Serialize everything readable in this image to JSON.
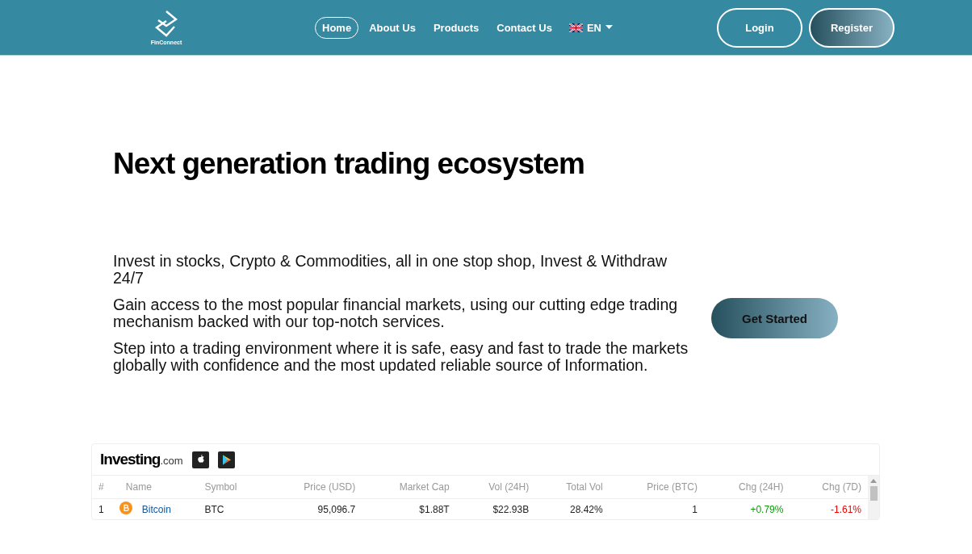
{
  "header": {
    "logo_text": "FinConnect",
    "nav": [
      {
        "label": "Home",
        "selected": true
      },
      {
        "label": "About Us",
        "selected": false
      },
      {
        "label": "Products",
        "selected": false
      },
      {
        "label": "Contact Us",
        "selected": false
      }
    ],
    "language": "EN",
    "buttons": [
      {
        "label": "Login",
        "kind": "outline"
      },
      {
        "label": "Register",
        "kind": "gradient"
      }
    ]
  },
  "hero": {
    "title": "Next generation trading ecosystem",
    "paragraphs": [
      "Invest in stocks, Crypto & Commodities, all in one stop shop, Invest & Withdraw 24/7",
      "Gain access to the most popular financial markets, using our cutting edge trading mechanism backed with our top-notch services.",
      "Step into a trading environment where it is safe, easy and fast to trade the markets globally with confidence and the most updated reliable source of Information."
    ],
    "cta": "Get Started"
  },
  "widget": {
    "brand": "Investing",
    "brand_suffix": ".com",
    "columns": [
      "#",
      "Name",
      "Symbol",
      "Price (USD)",
      "Market Cap",
      "Vol (24H)",
      "Total Vol",
      "Price (BTC)",
      "Chg (24H)",
      "Chg (7D)"
    ],
    "rows": [
      {
        "cells": [
          {
            "text": "1",
            "kind": "plain"
          },
          {
            "text": "Bitcoin",
            "kind": "link"
          },
          {
            "text": "BTC",
            "kind": "plain"
          },
          {
            "text": "95,096.7",
            "kind": "num"
          },
          {
            "text": "$1.88T",
            "kind": "num"
          },
          {
            "text": "$22.93B",
            "kind": "num"
          },
          {
            "text": "28.42%",
            "kind": "num"
          },
          {
            "text": "1",
            "kind": "num"
          },
          {
            "text": "+0.79%",
            "kind": "up"
          },
          {
            "text": "-1.61%",
            "kind": "down"
          }
        ]
      }
    ]
  }
}
